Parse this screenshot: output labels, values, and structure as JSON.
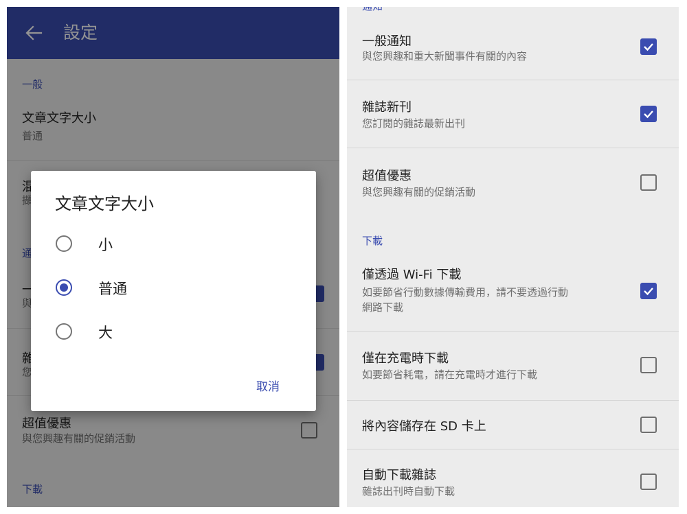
{
  "left": {
    "appbar": {
      "back_icon": "arrow-left-icon",
      "title": "設定"
    },
    "section_general": "一般",
    "font_size_setting": {
      "title": "文章文字大小",
      "value": "普通"
    },
    "partial_row2": {
      "title": "混",
      "subtitle": "擷"
    },
    "section_notify_partial": "通",
    "partial_row3": {
      "title": "一",
      "subtitle": "與"
    },
    "partial_row4": {
      "title": "雜",
      "subtitle": "您"
    },
    "deals": {
      "title": "超值優惠",
      "subtitle": "與您興趣有關的促銷活動",
      "checked": false
    },
    "section_download": "下載",
    "dialog": {
      "title": "文章文字大小",
      "options": [
        {
          "label": "小",
          "selected": false
        },
        {
          "label": "普通",
          "selected": true
        },
        {
          "label": "大",
          "selected": false
        }
      ],
      "cancel": "取消"
    }
  },
  "right": {
    "section_notify_partial": "通知",
    "items": [
      {
        "title": "一般通知",
        "subtitle": "與您興趣和重大新聞事件有關的內容",
        "checked": true
      },
      {
        "title": "雜誌新刊",
        "subtitle": "您訂閱的雜誌最新出刊",
        "checked": true
      },
      {
        "title": "超值優惠",
        "subtitle": "與您興趣有關的促銷活動",
        "checked": false
      }
    ],
    "section_download": "下載",
    "download_items": [
      {
        "title": "僅透過 Wi-Fi 下載",
        "subtitle": "如要節省行動數據傳輸費用，請不要透過行動",
        "subtitle2": "網路下載",
        "checked": true
      },
      {
        "title": "僅在充電時下載",
        "subtitle": "如要節省耗電，請在充電時才進行下載",
        "checked": false
      },
      {
        "title": "將內容儲存在 SD 卡上",
        "checked": false
      },
      {
        "title": "自動下載雜誌",
        "subtitle": "雜誌出刊時自動下載",
        "checked": false
      }
    ]
  },
  "colors": {
    "primary": "#3a4cb0",
    "background": "#ececec",
    "text": "#212121",
    "secondary_text": "#6f6f6f"
  }
}
